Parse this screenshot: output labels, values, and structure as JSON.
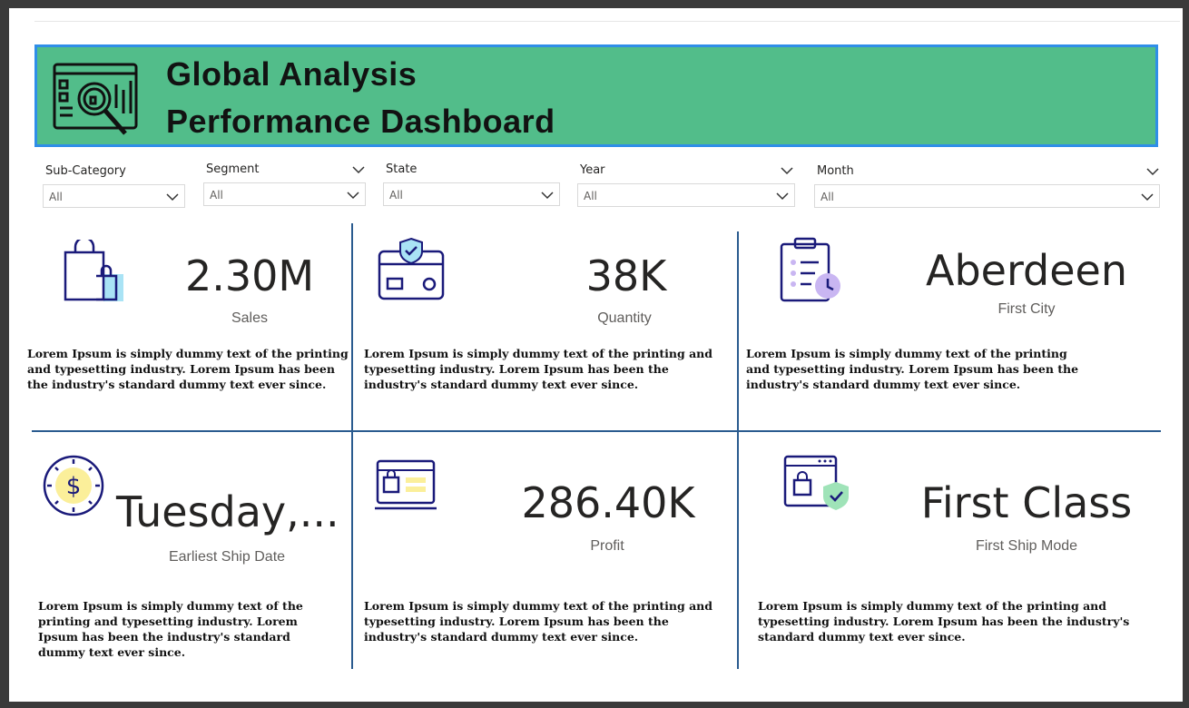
{
  "header": {
    "title_line1": "Global Analysis",
    "title_line2": "Performance Dashboard",
    "logo_icon": "analytics-magnifier-icon"
  },
  "filters": [
    {
      "label": "Sub-Category",
      "value": "All"
    },
    {
      "label": "Segment",
      "value": "All"
    },
    {
      "label": "State",
      "value": "All"
    },
    {
      "label": "Year",
      "value": "All"
    },
    {
      "label": "Month",
      "value": "All"
    }
  ],
  "cards": [
    {
      "value": "2.30M",
      "caption": "Sales",
      "icon": "shopping-bag-icon",
      "description": "Lorem Ipsum is simply dummy text of the printing and typesetting industry. Lorem Ipsum has been the industry's standard dummy text ever since."
    },
    {
      "value": "38K",
      "caption": "Quantity",
      "icon": "credit-card-shield-icon",
      "description": "Lorem Ipsum is simply dummy text of the printing and typesetting industry. Lorem Ipsum has been the industry's standard dummy text ever since."
    },
    {
      "value": "Aberdeen",
      "caption": "First City",
      "icon": "clipboard-clock-icon",
      "description": "Lorem Ipsum is simply dummy text of the printing and typesetting industry. Lorem Ipsum has been the industry's standard dummy text ever since."
    },
    {
      "value": "Tuesday,...",
      "caption": "Earliest Ship Date",
      "icon": "dollar-coin-icon",
      "description": "Lorem Ipsum is simply dummy text of the printing and typesetting industry. Lorem Ipsum has been the industry's standard dummy text ever since."
    },
    {
      "value": "286.40K",
      "caption": "Profit",
      "icon": "laptop-shop-icon",
      "description": "Lorem Ipsum is simply dummy text of the printing and typesetting industry. Lorem Ipsum has been the industry's standard dummy text ever since."
    },
    {
      "value": "First Class",
      "caption": "First Ship Mode",
      "icon": "browser-bag-shield-icon",
      "description": "Lorem Ipsum is simply dummy text of the printing and typesetting industry. Lorem Ipsum has been the industry's standard dummy text ever since."
    }
  ],
  "colors": {
    "banner_bg": "#52bd8a",
    "banner_border": "#2f8ee8",
    "divider": "#2a5b8f",
    "icon_stroke": "#1a1a7a",
    "icon_accent_blue": "#a9e3f5",
    "icon_accent_purple": "#c9b6f2",
    "icon_accent_yellow": "#fbef9a",
    "icon_accent_green": "#9fe3b8"
  }
}
